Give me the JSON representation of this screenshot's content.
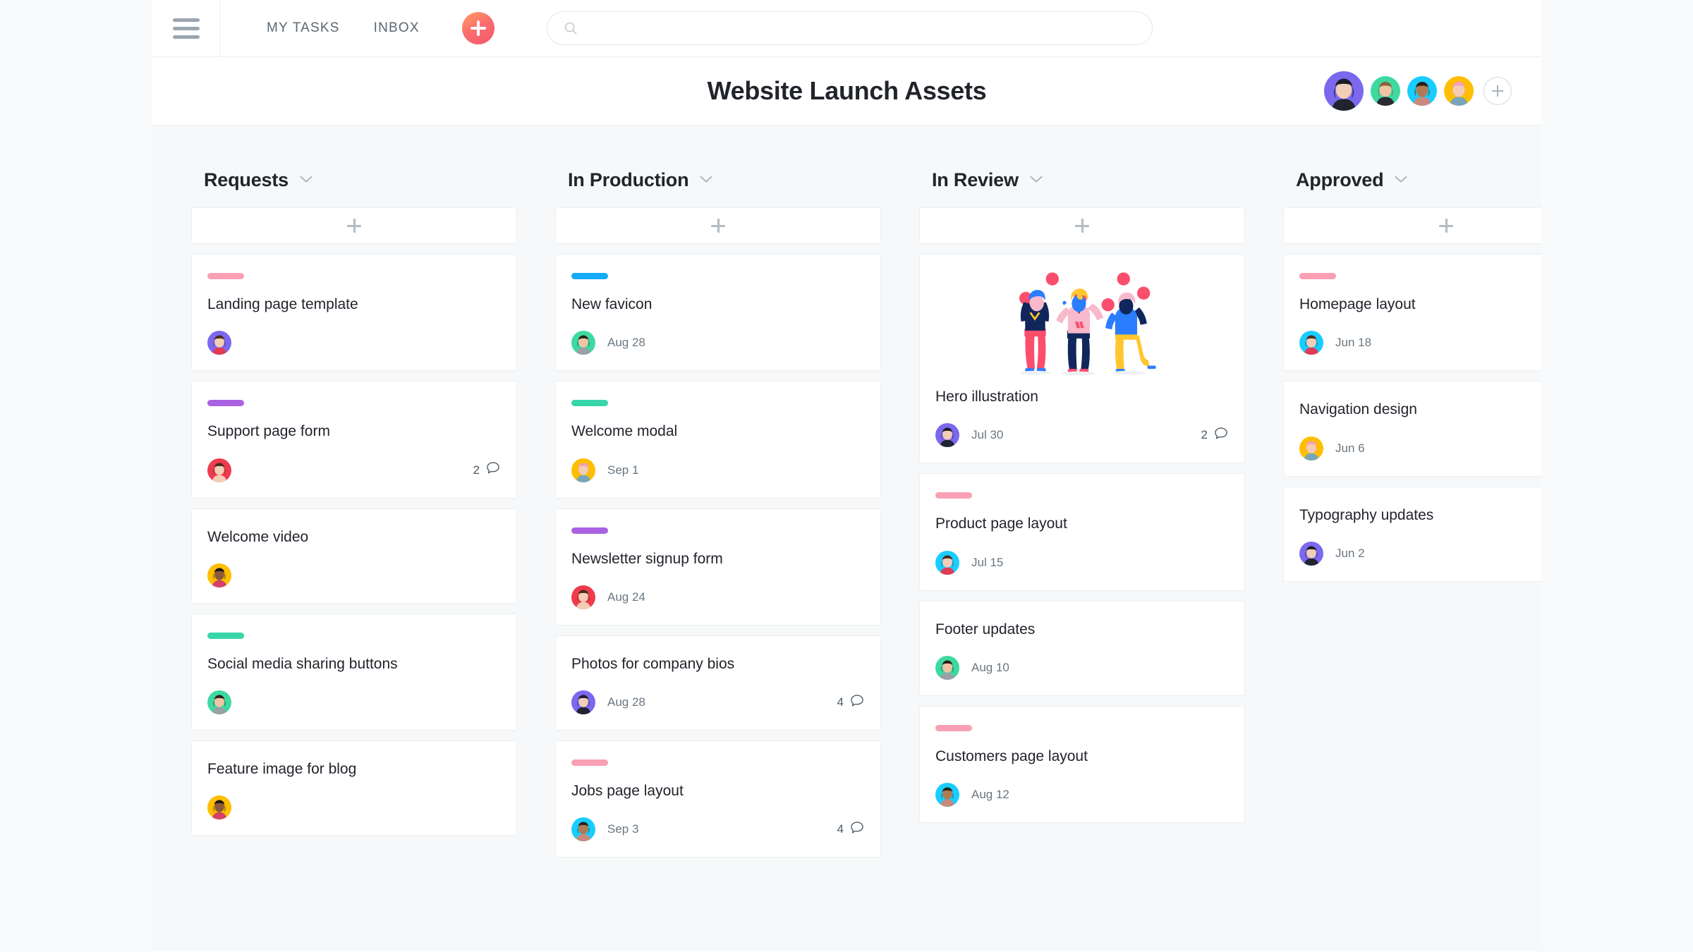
{
  "nav": {
    "hamburger_icon": "hamburger-menu-icon",
    "links": [
      {
        "label": "MY TASKS"
      },
      {
        "label": "INBOX"
      }
    ],
    "add_button_icon": "plus-icon",
    "search": {
      "placeholder": "",
      "value": "",
      "icon": "search-icon"
    }
  },
  "header": {
    "title": "Website Launch Assets",
    "members": [
      {
        "name": "member-1",
        "bg": "#7b68ee",
        "skin": "#f2cdb7",
        "hair": "#1b1b26",
        "shirt": "#1f2430",
        "lead": true
      },
      {
        "name": "member-2",
        "bg": "#3dd9a0",
        "skin": "#f0c4a4",
        "hair": "#8c6239",
        "shirt": "#2a2a33",
        "lead": false
      },
      {
        "name": "member-3",
        "bg": "#19cdff",
        "skin": "#b07a52",
        "hair": "#2a1f1a",
        "shirt": "#c8897c",
        "lead": false
      },
      {
        "name": "member-4",
        "bg": "#ffbe00",
        "skin": "#f3cdb6",
        "hair": "#f2a0c0",
        "shirt": "#77a6b8",
        "lead": false
      }
    ],
    "add_member_icon": "plus-circle-icon"
  },
  "board": {
    "add_card_icon": "plus-icon",
    "chevron_icon": "chevron-down-icon",
    "comment_icon": "speech-bubble-icon",
    "tag_colors": {
      "pink": "#f9a0b4",
      "purple": "#aa62e3",
      "teal": "#37d5a8",
      "blue": "#14aaf5"
    },
    "columns": [
      {
        "title": "Requests",
        "cards": [
          {
            "title": "Landing page template",
            "tag": "pink",
            "due": "",
            "comments": "",
            "assignee": {
              "bg": "#7b68ee",
              "skin": "#f3cdb6",
              "hair": "#4a2c1c",
              "shirt": "#e03a54"
            }
          },
          {
            "title": "Support page form",
            "tag": "purple",
            "due": "",
            "comments": "2",
            "assignee": {
              "bg": "#ee3b4e",
              "skin": "#f3cdb6",
              "hair": "#4a2c1c",
              "shirt": "#f3cdb6"
            }
          },
          {
            "title": "Welcome video",
            "tag": "",
            "due": "",
            "comments": "",
            "assignee": {
              "bg": "#ffbe00",
              "skin": "#8a5a3b",
              "hair": "#1b1210",
              "shirt": "#d2426a"
            }
          },
          {
            "title": "Social media sharing buttons",
            "tag": "teal",
            "due": "",
            "comments": "",
            "assignee": {
              "bg": "#3dd9a0",
              "skin": "#f0c4a4",
              "hair": "#2b2018",
              "shirt": "#9aa0a6"
            }
          },
          {
            "title": "Feature image for blog",
            "tag": "",
            "due": "",
            "comments": "",
            "assignee": {
              "bg": "#ffbe00",
              "skin": "#8a5a3b",
              "hair": "#1b1210",
              "shirt": "#d2426a"
            }
          }
        ]
      },
      {
        "title": "In Production",
        "cards": [
          {
            "title": "New favicon",
            "tag": "blue",
            "due": "Aug 28",
            "comments": "",
            "assignee": {
              "bg": "#3dd9a0",
              "skin": "#f0c4a4",
              "hair": "#2b2018",
              "shirt": "#9aa0a6"
            }
          },
          {
            "title": "Welcome modal",
            "tag": "teal",
            "due": "Sep 1",
            "comments": "",
            "assignee": {
              "bg": "#ffbe00",
              "skin": "#f3cdb6",
              "hair": "#f2a0c0",
              "shirt": "#77a6b8"
            }
          },
          {
            "title": "Newsletter signup form",
            "tag": "purple",
            "due": "Aug 24",
            "comments": "",
            "assignee": {
              "bg": "#ee3b4e",
              "skin": "#f3cdb6",
              "hair": "#4a2c1c",
              "shirt": "#f3cdb6"
            }
          },
          {
            "title": "Photos for company bios",
            "tag": "",
            "due": "Aug 28",
            "comments": "4",
            "assignee": {
              "bg": "#7b68ee",
              "skin": "#f2cdb7",
              "hair": "#1b1b26",
              "shirt": "#1f2430"
            }
          },
          {
            "title": "Jobs page layout",
            "tag": "pink",
            "due": "Sep 3",
            "comments": "4",
            "assignee": {
              "bg": "#19cdff",
              "skin": "#b07a52",
              "hair": "#2a1f1a",
              "shirt": "#c8897c"
            }
          }
        ]
      },
      {
        "title": "In Review",
        "cards": [
          {
            "title": "Hero illustration",
            "tag": "",
            "media": "juggling-people-illustration",
            "due": "Jul 30",
            "comments": "2",
            "assignee": {
              "bg": "#7b68ee",
              "skin": "#f2cdb7",
              "hair": "#1b1b26",
              "shirt": "#1f2430"
            }
          },
          {
            "title": "Product page layout",
            "tag": "pink",
            "due": "Jul 15",
            "comments": "",
            "assignee": {
              "bg": "#19cdff",
              "skin": "#f3cdb6",
              "hair": "#4a2c1c",
              "shirt": "#e03a54"
            }
          },
          {
            "title": "Footer updates",
            "tag": "",
            "due": "Aug 10",
            "comments": "",
            "assignee": {
              "bg": "#3dd9a0",
              "skin": "#f0c4a4",
              "hair": "#2b2018",
              "shirt": "#9aa0a6"
            }
          },
          {
            "title": "Customers page layout",
            "tag": "pink",
            "due": "Aug 12",
            "comments": "",
            "assignee": {
              "bg": "#19cdff",
              "skin": "#b07a52",
              "hair": "#2a1f1a",
              "shirt": "#c8897c"
            }
          }
        ]
      },
      {
        "title": "Approved",
        "cards": [
          {
            "title": "Homepage layout",
            "tag": "pink",
            "due": "Jun 18",
            "comments": "",
            "assignee": {
              "bg": "#19cdff",
              "skin": "#f3cdb6",
              "hair": "#4a2c1c",
              "shirt": "#e03a54"
            }
          },
          {
            "title": "Navigation design",
            "tag": "",
            "due": "Jun 6",
            "comments": "",
            "assignee": {
              "bg": "#ffbe00",
              "skin": "#f3cdb6",
              "hair": "#f2a0c0",
              "shirt": "#77a6b8"
            }
          },
          {
            "title": "Typography updates",
            "tag": "",
            "due": "Jun 2",
            "comments": "",
            "assignee": {
              "bg": "#7b68ee",
              "skin": "#f2cdb7",
              "hair": "#1b1b26",
              "shirt": "#1f2430"
            }
          }
        ]
      }
    ]
  }
}
